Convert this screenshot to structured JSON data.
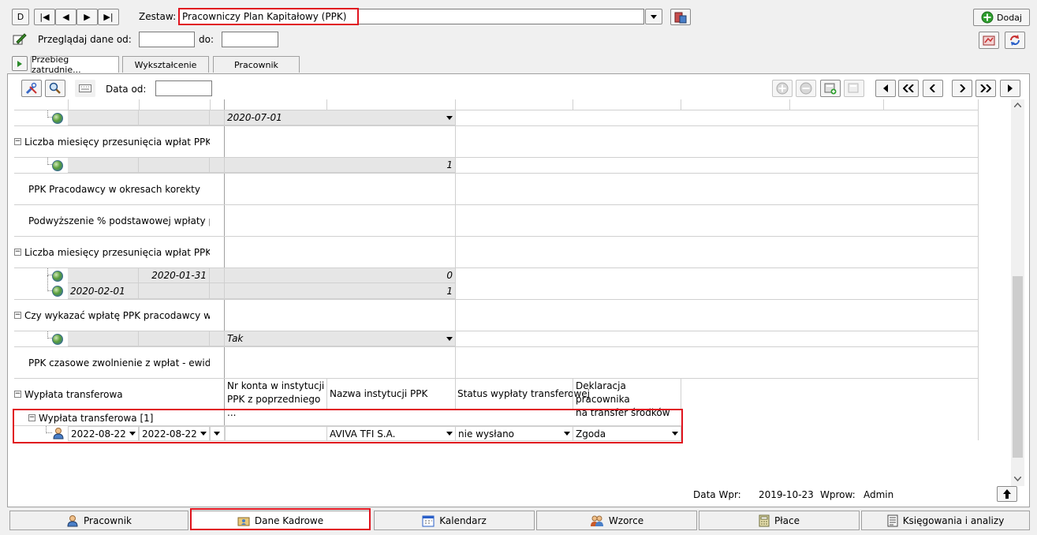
{
  "toolbar": {
    "nav_buttons": [
      "D",
      "|◀",
      "◀",
      "▶",
      "▶|"
    ],
    "zestaw_label": "Zestaw:",
    "zestaw_value": "Pracowniczy Plan Kapitałowy (PPK)",
    "dodaj_label": "Dodaj",
    "przegladaj_label": "Przeglądaj dane od:",
    "do_label": "do:",
    "przegladaj_from": "",
    "przegladaj_to": ""
  },
  "tabs": [
    "Przebieg zatrudnie...",
    "Wykształcenie",
    "Pracownik"
  ],
  "inner_toolbar": {
    "data_od_label": "Data od:",
    "data_od_value": ""
  },
  "grid": {
    "row_date_1": "2020-07-01",
    "label_przesuniecia": "Liczba miesięcy przesunięcia wpłat PPK",
    "value_przesuniecia": "1",
    "label_korekty": "PPK Pracodawcy w okresach korekty",
    "label_podwyzszenie": "Podwyższenie % podstawowej wpłaty pra...",
    "label_przesuniecia_w": "Liczba miesięcy przesunięcia wpłat PPK w...",
    "sub1_date_to": "2020-01-31",
    "sub1_value": "0",
    "sub2_date_from": "2020-02-01",
    "sub2_value": "1",
    "label_wykazac": "Czy wykazać wpłatę PPK pracodawcy w Z...",
    "value_tak": "Tak",
    "label_zwolnienie": "PPK czasowe zwolnienie z wpłat - ewiden...",
    "label_wyplata": "Wypłata transferowa",
    "col_nr_konta_1": "Nr konta w instytucji",
    "col_nr_konta_2": "PPK z poprzedniego ...",
    "col_nazwa": "Nazwa instytucji PPK",
    "col_status": "Status wypłaty transferowej",
    "col_deklaracja_1": "Deklaracja pracownika",
    "col_deklaracja_2": "na transfer środków",
    "label_wyplata_1": "Wypłata transferowa [1]",
    "wyplata_date_from": "2022-08-22",
    "wyplata_date_to": "2022-08-22",
    "wyplata_instytucja": "AVIVA TFI S.A.",
    "wyplata_status": "nie wysłano",
    "wyplata_deklaracja": "Zgoda"
  },
  "footer_info": {
    "data_wpr_label": "Data Wpr:",
    "data_wpr_value": "2019-10-23",
    "wprow_label": "Wprow:",
    "wprow_value": "Admin"
  },
  "bottom_tabs": [
    "Pracownik",
    "Dane Kadrowe",
    "Kalendarz",
    "Wzorce",
    "Płace",
    "Księgowania i analizy"
  ],
  "colors": {
    "highlight": "#e0141e",
    "dodaj_green": "#2e9e2e"
  }
}
